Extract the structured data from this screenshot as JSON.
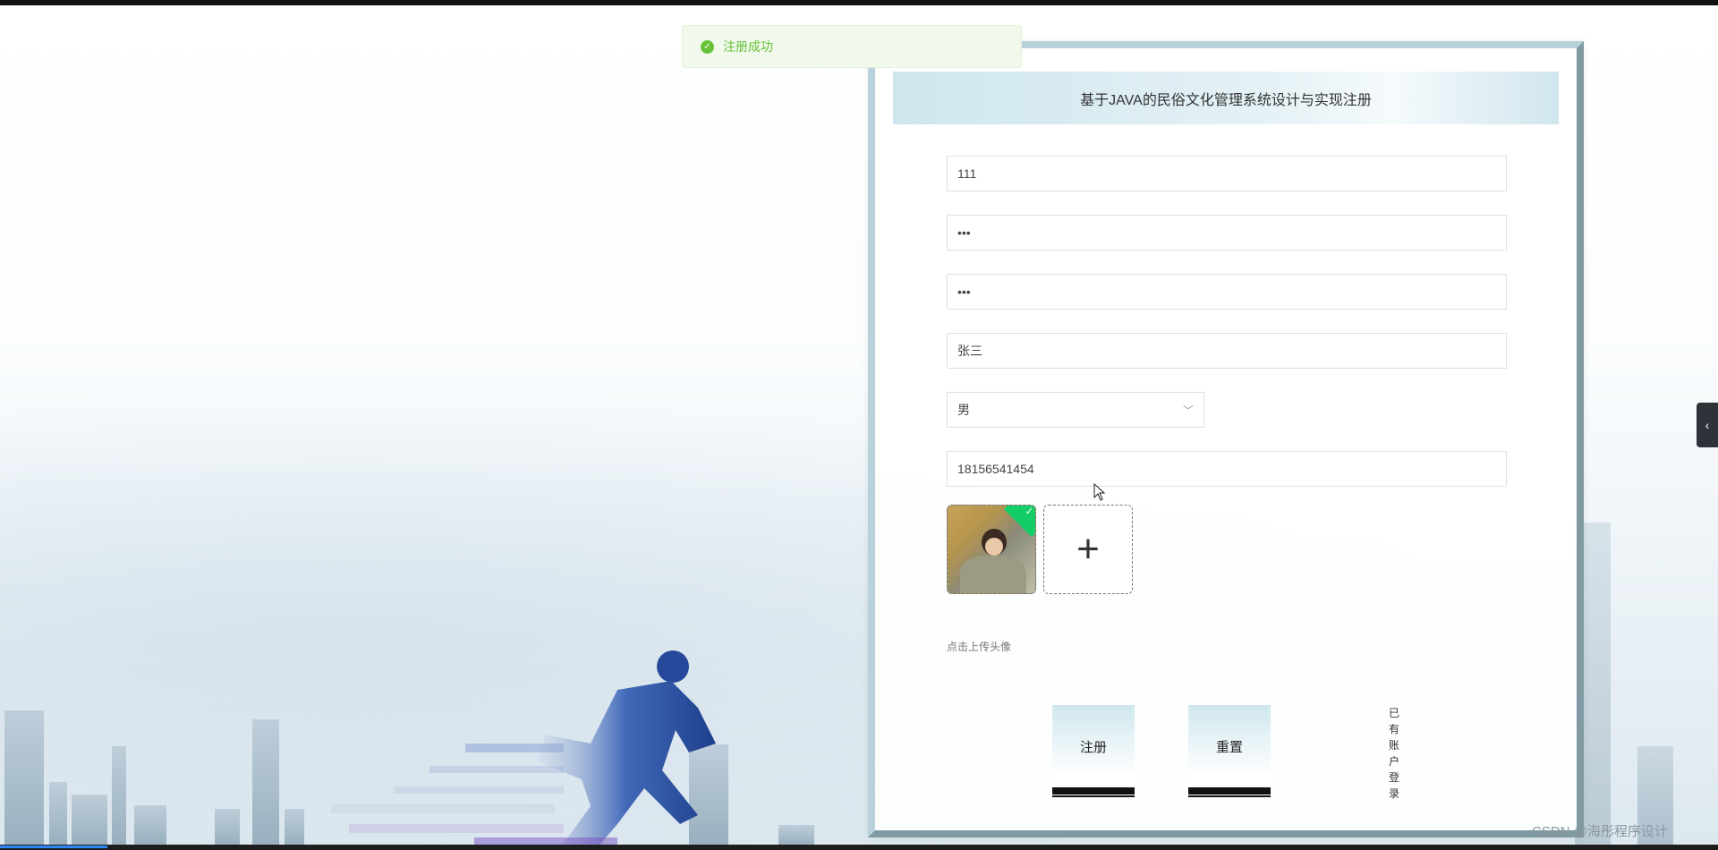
{
  "toast": {
    "message": "注册成功",
    "icon": "check-circle-icon"
  },
  "form": {
    "title": "基于JAVA的民俗文化管理系统设计与实现注册",
    "username": "111",
    "password": "•••",
    "confirm_password": "•••",
    "name": "张三",
    "gender": {
      "selected": "男",
      "icon": "chevron-down-icon"
    },
    "phone": "18156541454",
    "avatar_hint": "点击上传头像",
    "register_label": "注册",
    "reset_label": "重置",
    "login_link": "已有账户登录"
  },
  "watermark": "CSDN @海彤程序设计",
  "colors": {
    "success": "#67c23a",
    "accent": "#13ce66",
    "panel_border": "#b7d2db"
  }
}
